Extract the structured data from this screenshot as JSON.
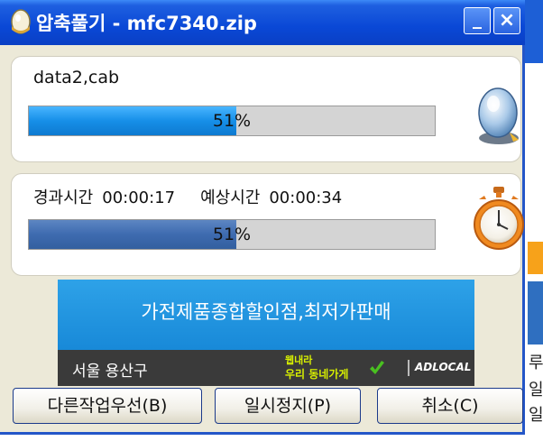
{
  "window": {
    "title": "압축풀기 - mfc7340.zip",
    "minimize_glyph": "_",
    "close_glyph": "×"
  },
  "file_panel": {
    "file_name": "data2,cab",
    "progress_text": "51%",
    "progress_value": 0.51,
    "icon": "disc-drive-icon"
  },
  "time_panel": {
    "elapsed_label": "경과시간",
    "elapsed_value": "00:00:17",
    "remaining_label": "예상시간",
    "remaining_value": "00:00:34",
    "progress_text": "51%",
    "progress_value": 0.51,
    "icon": "stopwatch-icon"
  },
  "ad": {
    "headline": "가전제품종합할인점,최저가판매",
    "location": "서울 용산구",
    "brand_line1": "웹내라",
    "brand_line2": "우리 동네가게",
    "network": "ADLOCAL"
  },
  "buttons": {
    "background_label": "다른작업우선(B)",
    "pause_label": "일시정지(P)",
    "cancel_label": "취소(C)"
  },
  "background_window": {
    "chars": [
      "│",
      "루",
      "일",
      "일"
    ]
  },
  "colors": {
    "titlebar": "#0a48d6",
    "progress_blue": "#168fe8",
    "progress_slate": "#3e6bb0",
    "ad_blue": "#1889d8",
    "ad_dark": "#3a3a3a",
    "brand_green": "#d8f000"
  }
}
